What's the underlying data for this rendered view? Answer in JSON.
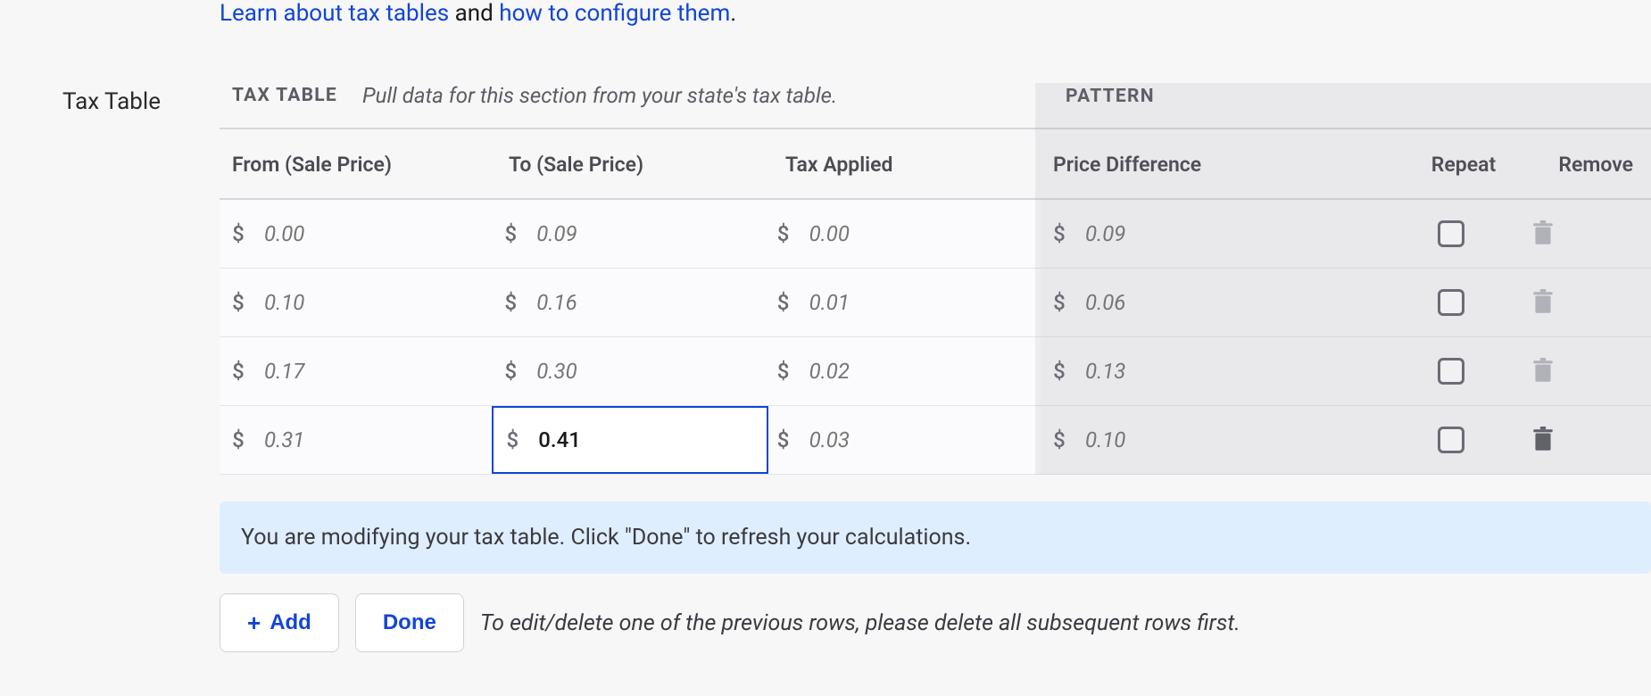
{
  "intro": {
    "link1": "Learn about tax tables",
    "text_between": " and ",
    "link2": "how to configure them",
    "trailing": "."
  },
  "side_label": "Tax Table",
  "header_band": {
    "tag_left": "TAX TABLE",
    "desc": "Pull data for this section from your state's tax table.",
    "tag_right": "PATTERN"
  },
  "columns": {
    "from": "From (Sale Price)",
    "to": "To (Sale Price)",
    "tax": "Tax Applied",
    "diff": "Price Difference",
    "repeat": "Repeat",
    "remove": "Remove"
  },
  "currency_symbol": "$",
  "rows": [
    {
      "from": "0.00",
      "to": "0.09",
      "tax": "0.00",
      "diff": "0.09",
      "repeat": false,
      "removable": false,
      "to_focused": false,
      "to_is_value": false
    },
    {
      "from": "0.10",
      "to": "0.16",
      "tax": "0.01",
      "diff": "0.06",
      "repeat": false,
      "removable": false,
      "to_focused": false,
      "to_is_value": false
    },
    {
      "from": "0.17",
      "to": "0.30",
      "tax": "0.02",
      "diff": "0.13",
      "repeat": false,
      "removable": false,
      "to_focused": false,
      "to_is_value": false
    },
    {
      "from": "0.31",
      "to": "0.41",
      "tax": "0.03",
      "diff": "0.10",
      "repeat": false,
      "removable": true,
      "to_focused": true,
      "to_is_value": true
    }
  ],
  "banner": "You are modifying your tax table. Click \"Done\" to refresh your calculations.",
  "actions": {
    "add": "Add",
    "done": "Done",
    "hint": "To edit/delete one of the previous rows, please delete all subsequent rows first."
  }
}
